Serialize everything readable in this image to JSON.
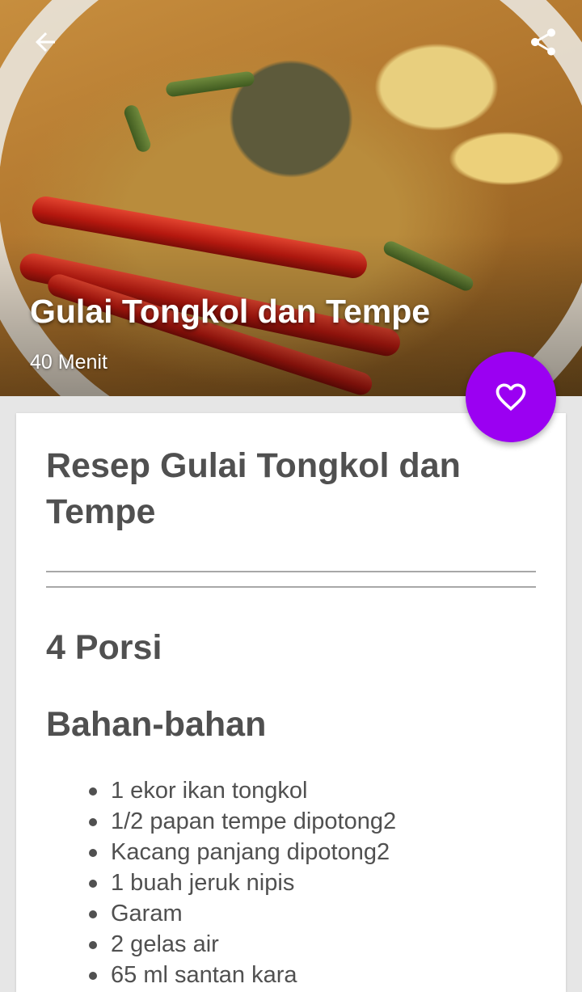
{
  "hero": {
    "title": "Gulai Tongkol dan Tempe",
    "duration": "40 Menit"
  },
  "icons": {
    "back": "arrow-left-icon",
    "share": "share-icon",
    "favorite": "heart-outline-icon"
  },
  "colors": {
    "fab": "#9b00f2",
    "text": "#505050",
    "background": "#e6e6e6"
  },
  "recipe": {
    "heading": "Resep Gulai Tongkol dan Tempe",
    "servings": "4 Porsi",
    "ingredients_title": "Bahan-bahan",
    "ingredients": [
      "1 ekor ikan tongkol",
      "1/2 papan tempe dipotong2",
      "Kacang panjang dipotong2",
      "1 buah jeruk nipis",
      "Garam",
      "2 gelas air",
      "65 ml santan kara"
    ]
  }
}
